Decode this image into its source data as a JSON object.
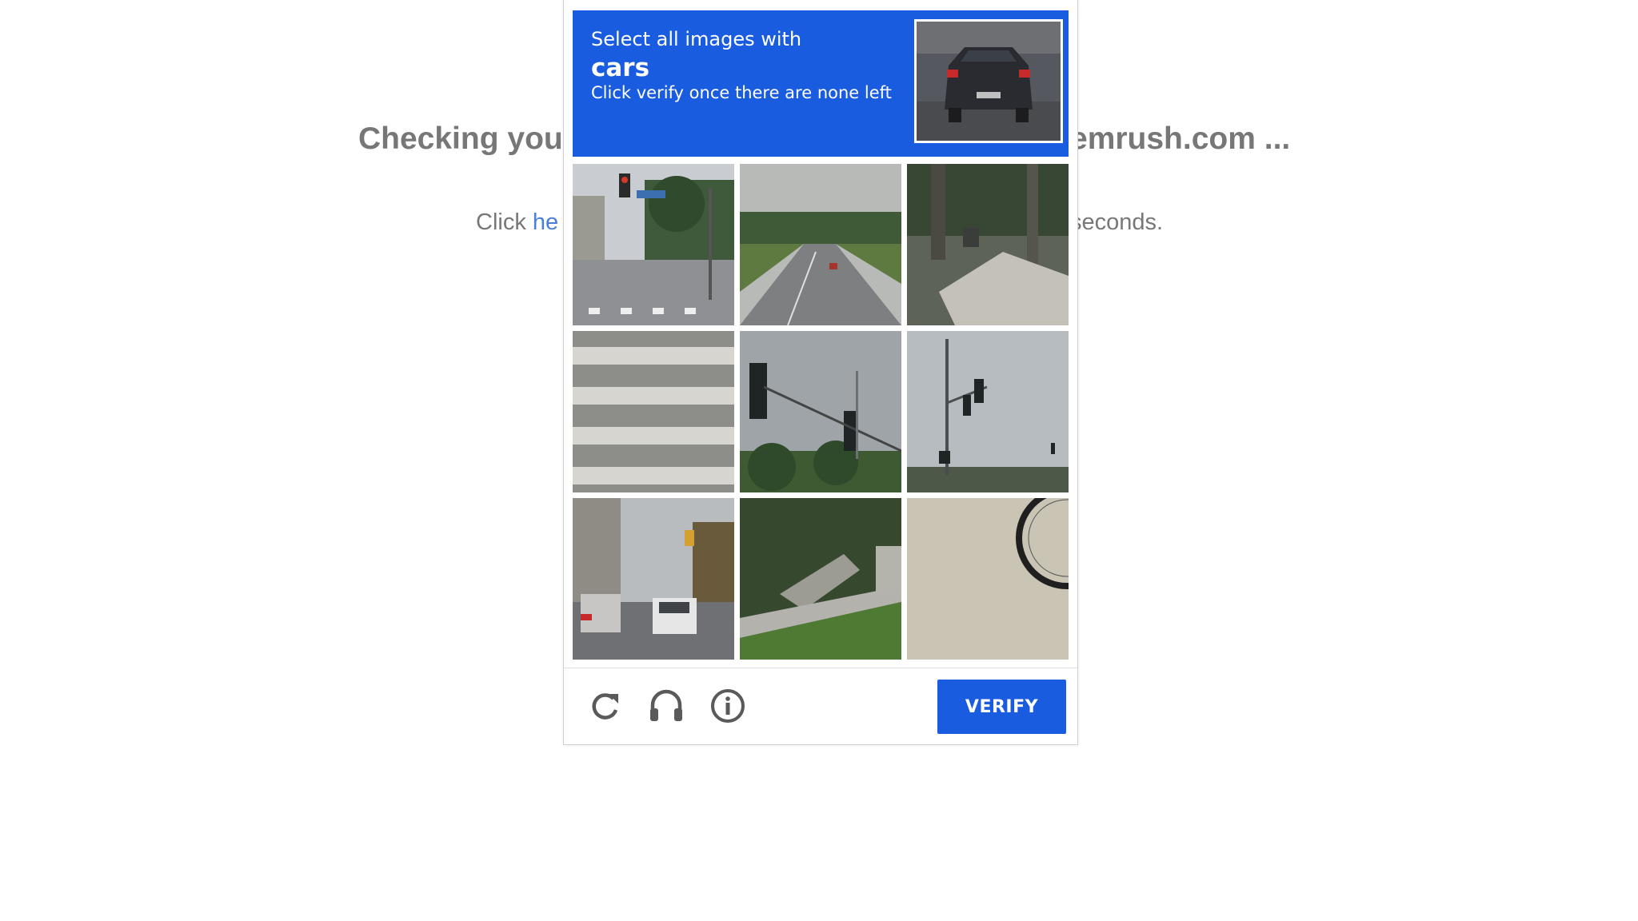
{
  "background": {
    "heading_left": "Checking you",
    "heading_right": "emrush.com ...",
    "sub_prefix": "Click ",
    "sub_link": "he",
    "sub_suffix": "seconds."
  },
  "captcha": {
    "instruction": "Select all images with",
    "target": "cars",
    "hint": "Click verify once there are none left",
    "verify_label": "VERIFY",
    "accent_color": "#1a5ce0",
    "tiles": [
      {
        "icon": "street-scene-traffic-light"
      },
      {
        "icon": "highway-road"
      },
      {
        "icon": "sidewalk-trees"
      },
      {
        "icon": "crosswalk"
      },
      {
        "icon": "traffic-lights-palms"
      },
      {
        "icon": "traffic-light-pole"
      },
      {
        "icon": "street-with-cars"
      },
      {
        "icon": "stairs-grass"
      },
      {
        "icon": "bicycle-wheel"
      }
    ],
    "footer_icons": [
      "reload-icon",
      "headphones-icon",
      "info-icon"
    ]
  }
}
